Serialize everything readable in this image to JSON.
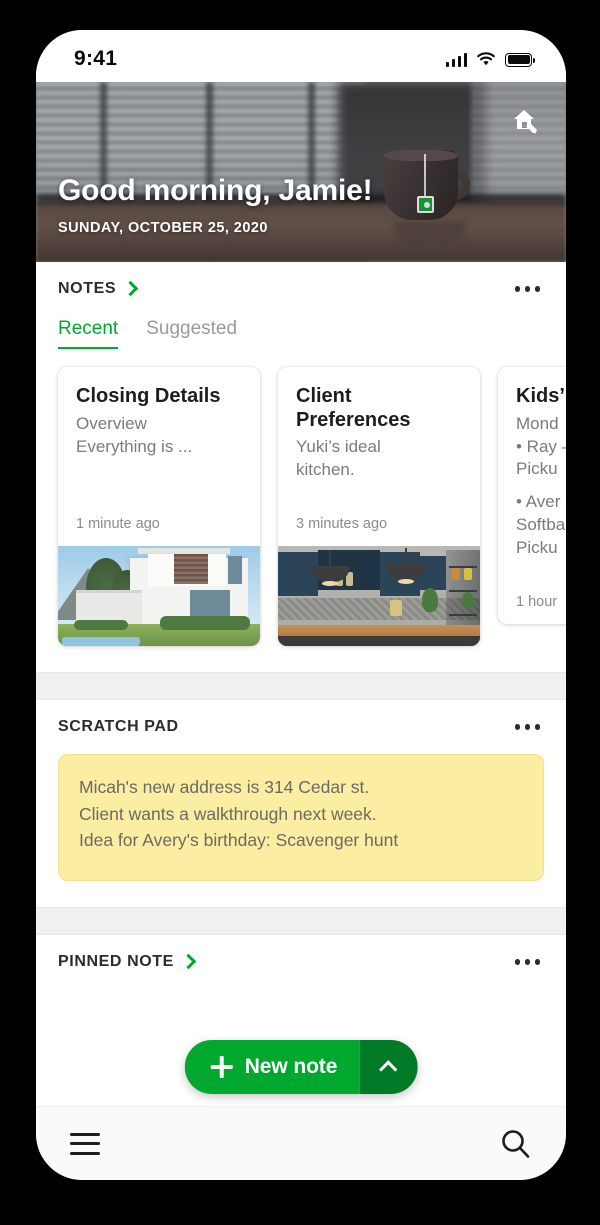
{
  "status_bar": {
    "time": "9:41",
    "cellular_icon": "signal-bars-icon",
    "wifi_icon": "wifi-icon",
    "battery_icon": "battery-full-icon"
  },
  "hero": {
    "greeting": "Good morning, Jamie!",
    "date": "SUNDAY, OCTOBER 25, 2020",
    "edit_home_icon": "home-edit-icon"
  },
  "notes_section": {
    "title": "NOTES",
    "chevron_icon": "chevron-right-icon",
    "overflow_icon": "more-options-icon",
    "tabs": [
      {
        "label": "Recent",
        "active": true
      },
      {
        "label": "Suggested",
        "active": false
      }
    ],
    "cards": [
      {
        "title": "Closing Details",
        "lines": [
          "Overview",
          "Everything is ..."
        ],
        "time": "1 minute ago",
        "thumbnail": "modern-house-photo"
      },
      {
        "title": "Client Preferences",
        "lines": [
          "Yuki’s ideal",
          "kitchen."
        ],
        "time": "3 minutes ago",
        "thumbnail": "blue-kitchen-photo"
      },
      {
        "title": "Kids’",
        "lines": [
          "Mond",
          "• Ray –",
          "Picku",
          "• Aver",
          "Softba",
          "Picku"
        ],
        "time": "1 hour",
        "thumbnail": "none"
      }
    ]
  },
  "scratch_pad": {
    "title": "SCRATCH PAD",
    "overflow_icon": "more-options-icon",
    "lines": [
      "Micah's new address is 314 Cedar st.",
      "Client wants a walkthrough next week.",
      "Idea for Avery's birthday: Scavenger hunt"
    ]
  },
  "pinned_note": {
    "title": "PINNED NOTE",
    "chevron_icon": "chevron-right-icon",
    "overflow_icon": "more-options-icon"
  },
  "fab": {
    "label": "New note",
    "plus_icon": "plus-icon",
    "expand_icon": "chevron-up-icon"
  },
  "bottom_bar": {
    "menu_icon": "hamburger-menu-icon",
    "search_icon": "search-icon"
  },
  "colors": {
    "accent_green": "#00a82d",
    "accent_green_dark": "#007a26",
    "scratch_yellow": "#fbeda2",
    "divider_gray": "#f0f0f0"
  }
}
